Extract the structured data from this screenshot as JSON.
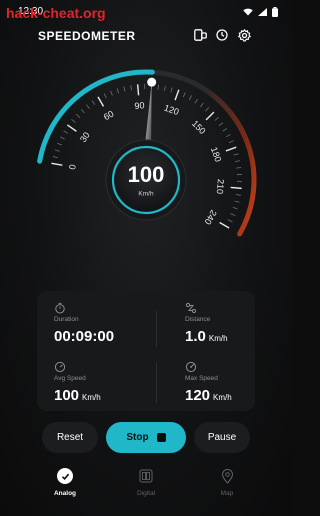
{
  "status_bar": {
    "time": "12:30"
  },
  "watermark": "hack-cheat.org",
  "header": {
    "title": "SPEEDOMETER"
  },
  "gauge": {
    "speed": 100,
    "unit": "Km/h",
    "min": 0,
    "max": 240,
    "ticks": [
      "0",
      "30",
      "60",
      "90",
      "120",
      "150",
      "180",
      "210",
      "240"
    ],
    "colors": {
      "accent": "#20b7c9",
      "hot": "#c23a1a",
      "track": "#2a2b2e"
    }
  },
  "stats": {
    "duration": {
      "label": "Duration",
      "value": "00:09:00"
    },
    "distance": {
      "label": "Distance",
      "value": "1.0",
      "unit": "Km/h"
    },
    "avg_speed": {
      "label": "Avg Speed",
      "value": "100",
      "unit": "Km/h"
    },
    "max_speed": {
      "label": "Max Speed",
      "value": "120",
      "unit": "Km/h"
    }
  },
  "controls": {
    "reset": "Reset",
    "stop": "Stop",
    "pause": "Pause"
  },
  "nav": {
    "items": [
      {
        "label": "Analog",
        "icon": "check-icon",
        "active": true
      },
      {
        "label": "Digital",
        "icon": "digital-icon",
        "active": false
      },
      {
        "label": "Map",
        "icon": "map-pin-icon",
        "active": false
      }
    ]
  }
}
